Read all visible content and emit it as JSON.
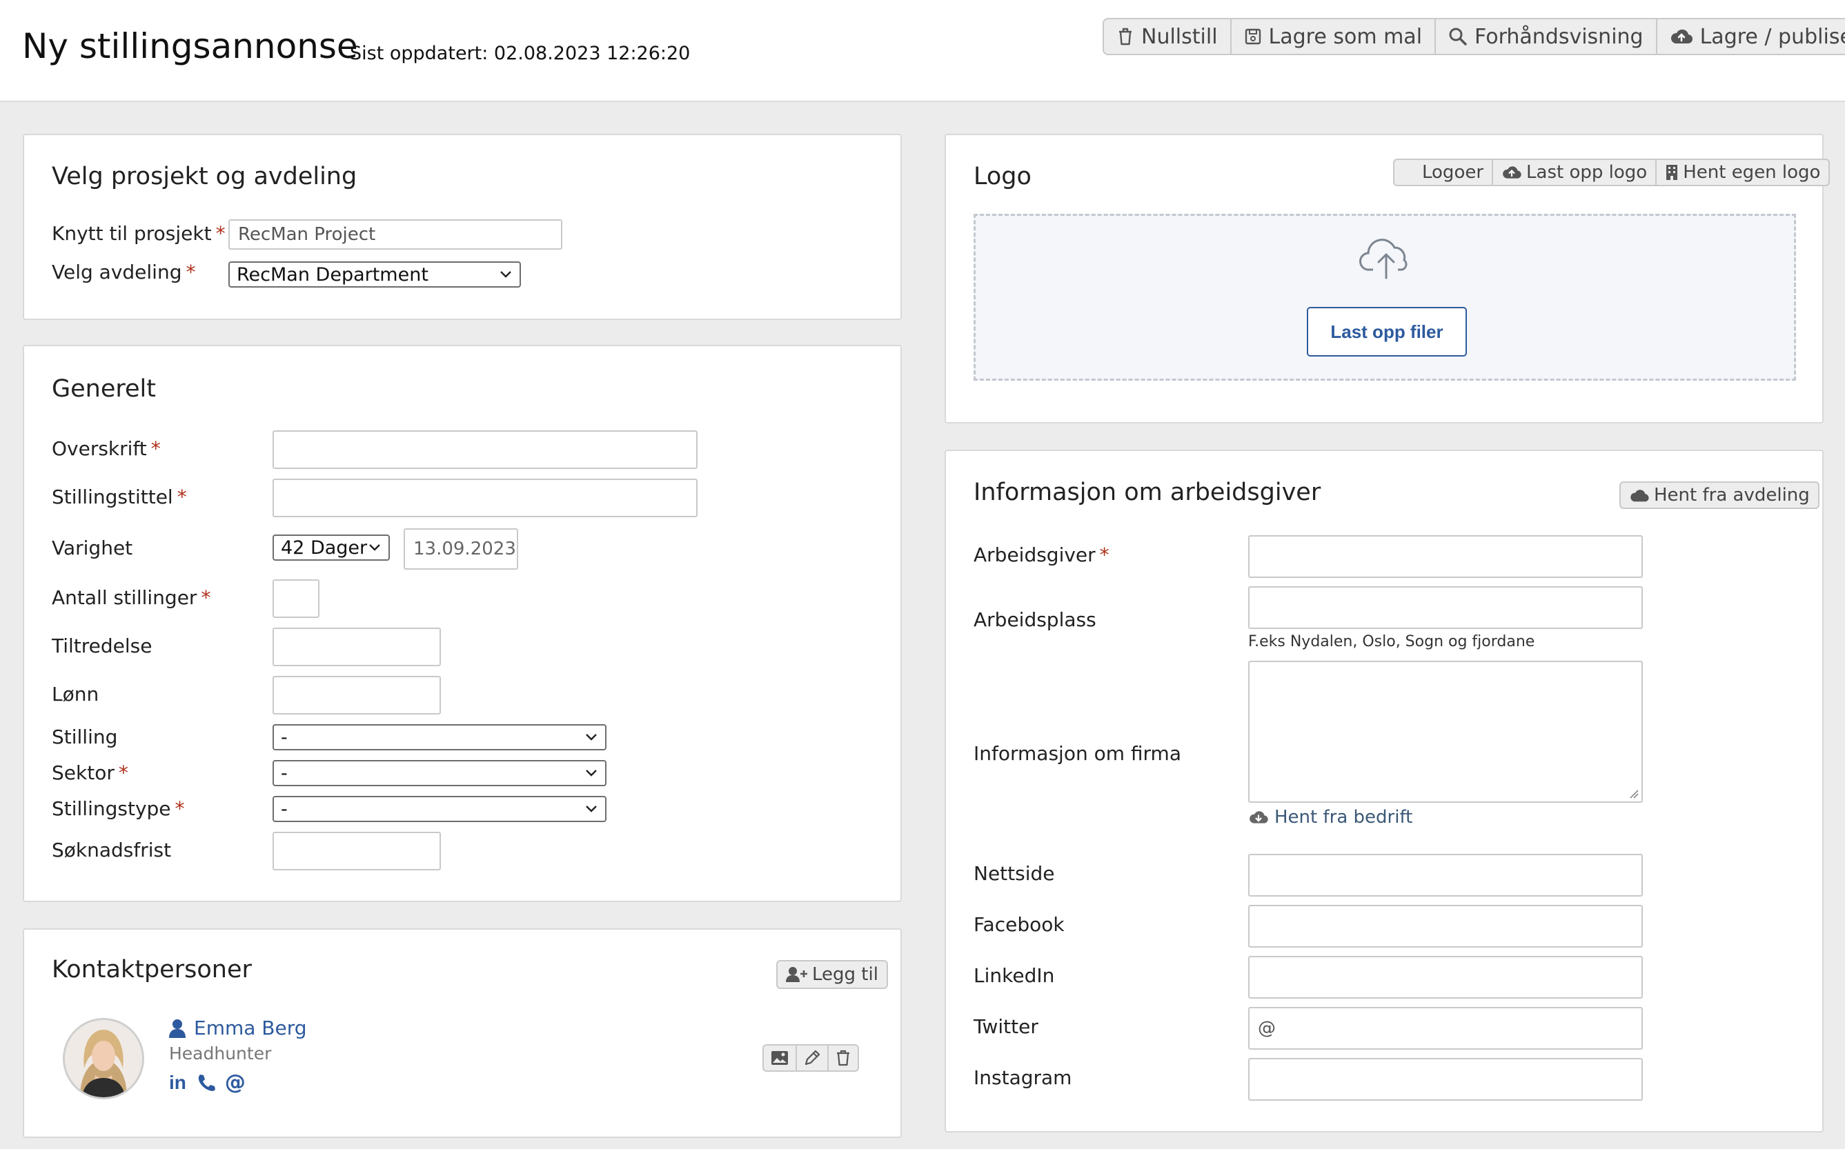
{
  "header": {
    "title": "Ny stillingsannonse",
    "updated": "Sist oppdatert: 02.08.2023 12:26:20",
    "buttons": {
      "reset": "Nullstill",
      "save_template": "Lagre som mal",
      "preview": "Forhåndsvisning",
      "publish": "Lagre / publiser"
    }
  },
  "project_panel": {
    "title": "Velg prosjekt og avdeling",
    "project_label": "Knytt til prosjekt",
    "project_value": "RecMan Project",
    "department_label": "Velg avdeling",
    "department_value": "RecMan Department"
  },
  "general_panel": {
    "title": "Generelt",
    "headline_label": "Overskrift",
    "job_title_label": "Stillingstittel",
    "duration_label": "Varighet",
    "duration_value": "42 Dager",
    "duration_date": "13.09.2023",
    "positions_label": "Antall stillinger",
    "start_label": "Tiltredelse",
    "salary_label": "Lønn",
    "position_label": "Stilling",
    "position_value": "-",
    "sector_label": "Sektor",
    "sector_value": "-",
    "type_label": "Stillingstype",
    "type_value": "-",
    "deadline_label": "Søknadsfrist"
  },
  "contacts_panel": {
    "title": "Kontaktpersoner",
    "add_label": "Legg til",
    "contact": {
      "name": "Emma Berg",
      "role": "Headhunter"
    }
  },
  "logo_panel": {
    "title": "Logo",
    "logos_label": "Logoer",
    "upload_logo_label": "Last opp logo",
    "own_logo_label": "Hent egen logo",
    "upload_files_label": "Last opp filer"
  },
  "employer_panel": {
    "title": "Informasjon om arbeidsgiver",
    "fetch_department_label": "Hent fra avdeling",
    "employer_label": "Arbeidsgiver",
    "workplace_label": "Arbeidsplass",
    "workplace_hint": "F.eks Nydalen, Oslo, Sogn og fjordane",
    "company_info_label": "Informasjon om firma",
    "fetch_company_label": "Hent fra bedrift",
    "website_label": "Nettside",
    "facebook_label": "Facebook",
    "linkedin_label": "LinkedIn",
    "twitter_label": "Twitter",
    "twitter_value": "@",
    "instagram_label": "Instagram"
  },
  "colors": {
    "required": "#b0301a",
    "link": "#2d5a9e",
    "upload_zone": "#f4f6fa"
  }
}
